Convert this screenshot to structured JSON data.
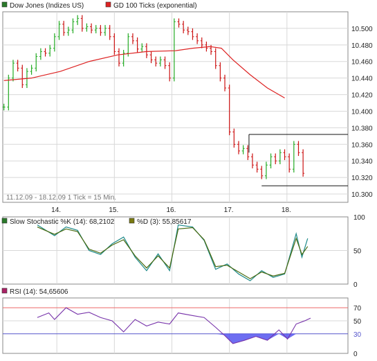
{
  "colors": {
    "up_bar": "#22aa22",
    "down_bar": "#cc1111",
    "ma_line": "#dd2222",
    "stoch_k": "#1f8a8a",
    "stoch_d": "#4a6a10",
    "rsi_line": "#7733aa",
    "rsi_fill": "#5555ee",
    "rsi_upper": "#ee6666",
    "rsi_lower": "#5555cc",
    "grid": "#d8d8d8",
    "legend_box_price": "#2a7a2a",
    "legend_box_ma": "#dd2222",
    "legend_box_stoch_k": "#2a7a2a",
    "legend_box_stoch_d": "#7a7a10",
    "legend_box_rsi": "#aa2266"
  },
  "chart_data": [
    {
      "type": "ohlc",
      "panel": "price",
      "legend": [
        {
          "name": "Dow Jones (Indizes US)",
          "icon": "square-green"
        },
        {
          "name": "GD 100 Ticks (exponential)",
          "icon": "square-red"
        }
      ],
      "ylim": [
        10290,
        10520
      ],
      "y_ticks": [
        "10.500",
        "10.480",
        "10.460",
        "10.440",
        "10.420",
        "10.400",
        "10.380",
        "10.360",
        "10.340",
        "10.320",
        "10.300"
      ],
      "y_tick_values": [
        10500,
        10480,
        10460,
        10440,
        10420,
        10400,
        10380,
        10360,
        10340,
        10320,
        10300
      ],
      "x_ticks": [
        "14.",
        "15.",
        "16.",
        "17.",
        "18."
      ],
      "x_tick_positions": [
        14,
        15,
        16,
        17,
        18
      ],
      "xlim": [
        13.0,
        19.0
      ],
      "info_text": "11.12.09 - 18.12.09  1 Tick = 15 Min.",
      "close_series": [
        [
          13.02,
          10405
        ],
        [
          13.1,
          10440
        ],
        [
          13.18,
          10458
        ],
        [
          13.26,
          10452
        ],
        [
          13.34,
          10432
        ],
        [
          13.42,
          10448
        ],
        [
          13.5,
          10452
        ],
        [
          13.58,
          10466
        ],
        [
          13.66,
          10472
        ],
        [
          13.74,
          10470
        ],
        [
          13.82,
          10476
        ],
        [
          13.9,
          10490
        ],
        [
          13.98,
          10505
        ],
        [
          14.06,
          10495
        ],
        [
          14.14,
          10498
        ],
        [
          14.22,
          10508
        ],
        [
          14.3,
          10512
        ],
        [
          14.38,
          10500
        ],
        [
          14.46,
          10502
        ],
        [
          14.54,
          10498
        ],
        [
          14.62,
          10500
        ],
        [
          14.7,
          10495
        ],
        [
          14.78,
          10500
        ],
        [
          14.86,
          10490
        ],
        [
          14.94,
          10472
        ],
        [
          15.02,
          10458
        ],
        [
          15.1,
          10470
        ],
        [
          15.18,
          10490
        ],
        [
          15.26,
          10485
        ],
        [
          15.34,
          10475
        ],
        [
          15.42,
          10478
        ],
        [
          15.5,
          10468
        ],
        [
          15.58,
          10462
        ],
        [
          15.66,
          10458
        ],
        [
          15.74,
          10462
        ],
        [
          15.82,
          10455
        ],
        [
          15.9,
          10440
        ],
        [
          15.98,
          10508
        ],
        [
          16.06,
          10505
        ],
        [
          16.14,
          10498
        ],
        [
          16.22,
          10496
        ],
        [
          16.3,
          10490
        ],
        [
          16.38,
          10485
        ],
        [
          16.46,
          10480
        ],
        [
          16.54,
          10476
        ],
        [
          16.62,
          10472
        ],
        [
          16.7,
          10455
        ],
        [
          16.78,
          10440
        ],
        [
          16.86,
          10428
        ],
        [
          16.94,
          10375
        ],
        [
          17.02,
          10360
        ],
        [
          17.1,
          10352
        ],
        [
          17.18,
          10355
        ],
        [
          17.26,
          10345
        ],
        [
          17.34,
          10335
        ],
        [
          17.42,
          10330
        ],
        [
          17.5,
          10322
        ],
        [
          17.58,
          10335
        ],
        [
          17.66,
          10345
        ],
        [
          17.74,
          10340
        ],
        [
          17.82,
          10350
        ],
        [
          17.9,
          10345
        ],
        [
          17.98,
          10330
        ],
        [
          18.06,
          10360
        ],
        [
          18.14,
          10350
        ],
        [
          18.22,
          10325
        ]
      ],
      "moving_average_series": [
        [
          13.02,
          10437
        ],
        [
          13.5,
          10440
        ],
        [
          14.0,
          10448
        ],
        [
          14.5,
          10460
        ],
        [
          15.0,
          10468
        ],
        [
          15.5,
          10472
        ],
        [
          16.0,
          10473
        ],
        [
          16.3,
          10476
        ],
        [
          16.6,
          10478
        ],
        [
          16.8,
          10476
        ],
        [
          17.0,
          10462
        ],
        [
          17.3,
          10444
        ],
        [
          17.6,
          10428
        ],
        [
          17.9,
          10416
        ]
      ],
      "highlight_box": {
        "x_start": 17.28,
        "x_end": 19.0,
        "y_high": 10372,
        "y_low": 10310
      }
    },
    {
      "type": "line",
      "panel": "stochastic",
      "ylim": [
        0,
        100
      ],
      "y_ticks": [
        "100",
        "50",
        "0"
      ],
      "y_tick_values": [
        100,
        50,
        0
      ],
      "series": [
        {
          "name": "Slow Stochastic %K (14): 68,2102",
          "color_key": "stoch_k",
          "values": [
            [
              13.6,
              88
            ],
            [
              13.9,
              72
            ],
            [
              14.1,
              85
            ],
            [
              14.3,
              80
            ],
            [
              14.5,
              50
            ],
            [
              14.7,
              44
            ],
            [
              14.9,
              60
            ],
            [
              15.1,
              70
            ],
            [
              15.3,
              40
            ],
            [
              15.5,
              20
            ],
            [
              15.7,
              45
            ],
            [
              15.9,
              20
            ],
            [
              16.05,
              88
            ],
            [
              16.3,
              85
            ],
            [
              16.5,
              65
            ],
            [
              16.7,
              22
            ],
            [
              16.9,
              30
            ],
            [
              17.1,
              15
            ],
            [
              17.3,
              5
            ],
            [
              17.5,
              20
            ],
            [
              17.7,
              10
            ],
            [
              17.9,
              15
            ],
            [
              18.1,
              75
            ],
            [
              18.2,
              40
            ],
            [
              18.3,
              68
            ]
          ]
        },
        {
          "name": "%D (3): 55,85617",
          "color_key": "stoch_d",
          "values": [
            [
              13.6,
              85
            ],
            [
              13.9,
              74
            ],
            [
              14.1,
              82
            ],
            [
              14.3,
              78
            ],
            [
              14.5,
              52
            ],
            [
              14.7,
              46
            ],
            [
              14.9,
              58
            ],
            [
              15.1,
              66
            ],
            [
              15.3,
              42
            ],
            [
              15.5,
              24
            ],
            [
              15.7,
              42
            ],
            [
              15.9,
              24
            ],
            [
              16.05,
              82
            ],
            [
              16.3,
              84
            ],
            [
              16.5,
              66
            ],
            [
              16.7,
              26
            ],
            [
              16.9,
              28
            ],
            [
              17.1,
              18
            ],
            [
              17.3,
              8
            ],
            [
              17.5,
              18
            ],
            [
              17.7,
              12
            ],
            [
              17.9,
              16
            ],
            [
              18.1,
              68
            ],
            [
              18.2,
              44
            ],
            [
              18.3,
              56
            ]
          ]
        }
      ]
    },
    {
      "type": "line",
      "panel": "rsi",
      "ylim": [
        0,
        85
      ],
      "y_ticks": [
        "70",
        "50",
        "30",
        "0"
      ],
      "y_tick_values": [
        70,
        50,
        30,
        0
      ],
      "thresholds": [
        70,
        30
      ],
      "series": [
        {
          "name": "RSI (14): 54,65606",
          "color_key": "rsi_line",
          "values": [
            [
              13.6,
              55
            ],
            [
              13.8,
              62
            ],
            [
              13.9,
              52
            ],
            [
              14.1,
              70
            ],
            [
              14.3,
              60
            ],
            [
              14.5,
              63
            ],
            [
              14.7,
              55
            ],
            [
              14.9,
              50
            ],
            [
              15.1,
              33
            ],
            [
              15.3,
              52
            ],
            [
              15.5,
              42
            ],
            [
              15.7,
              48
            ],
            [
              15.9,
              45
            ],
            [
              16.05,
              62
            ],
            [
              16.3,
              58
            ],
            [
              16.5,
              55
            ],
            [
              16.7,
              40
            ],
            [
              16.85,
              28
            ],
            [
              17.0,
              15
            ],
            [
              17.2,
              20
            ],
            [
              17.4,
              26
            ],
            [
              17.6,
              20
            ],
            [
              17.8,
              36
            ],
            [
              17.95,
              22
            ],
            [
              18.1,
              45
            ],
            [
              18.25,
              50
            ],
            [
              18.35,
              54
            ]
          ]
        }
      ]
    }
  ]
}
